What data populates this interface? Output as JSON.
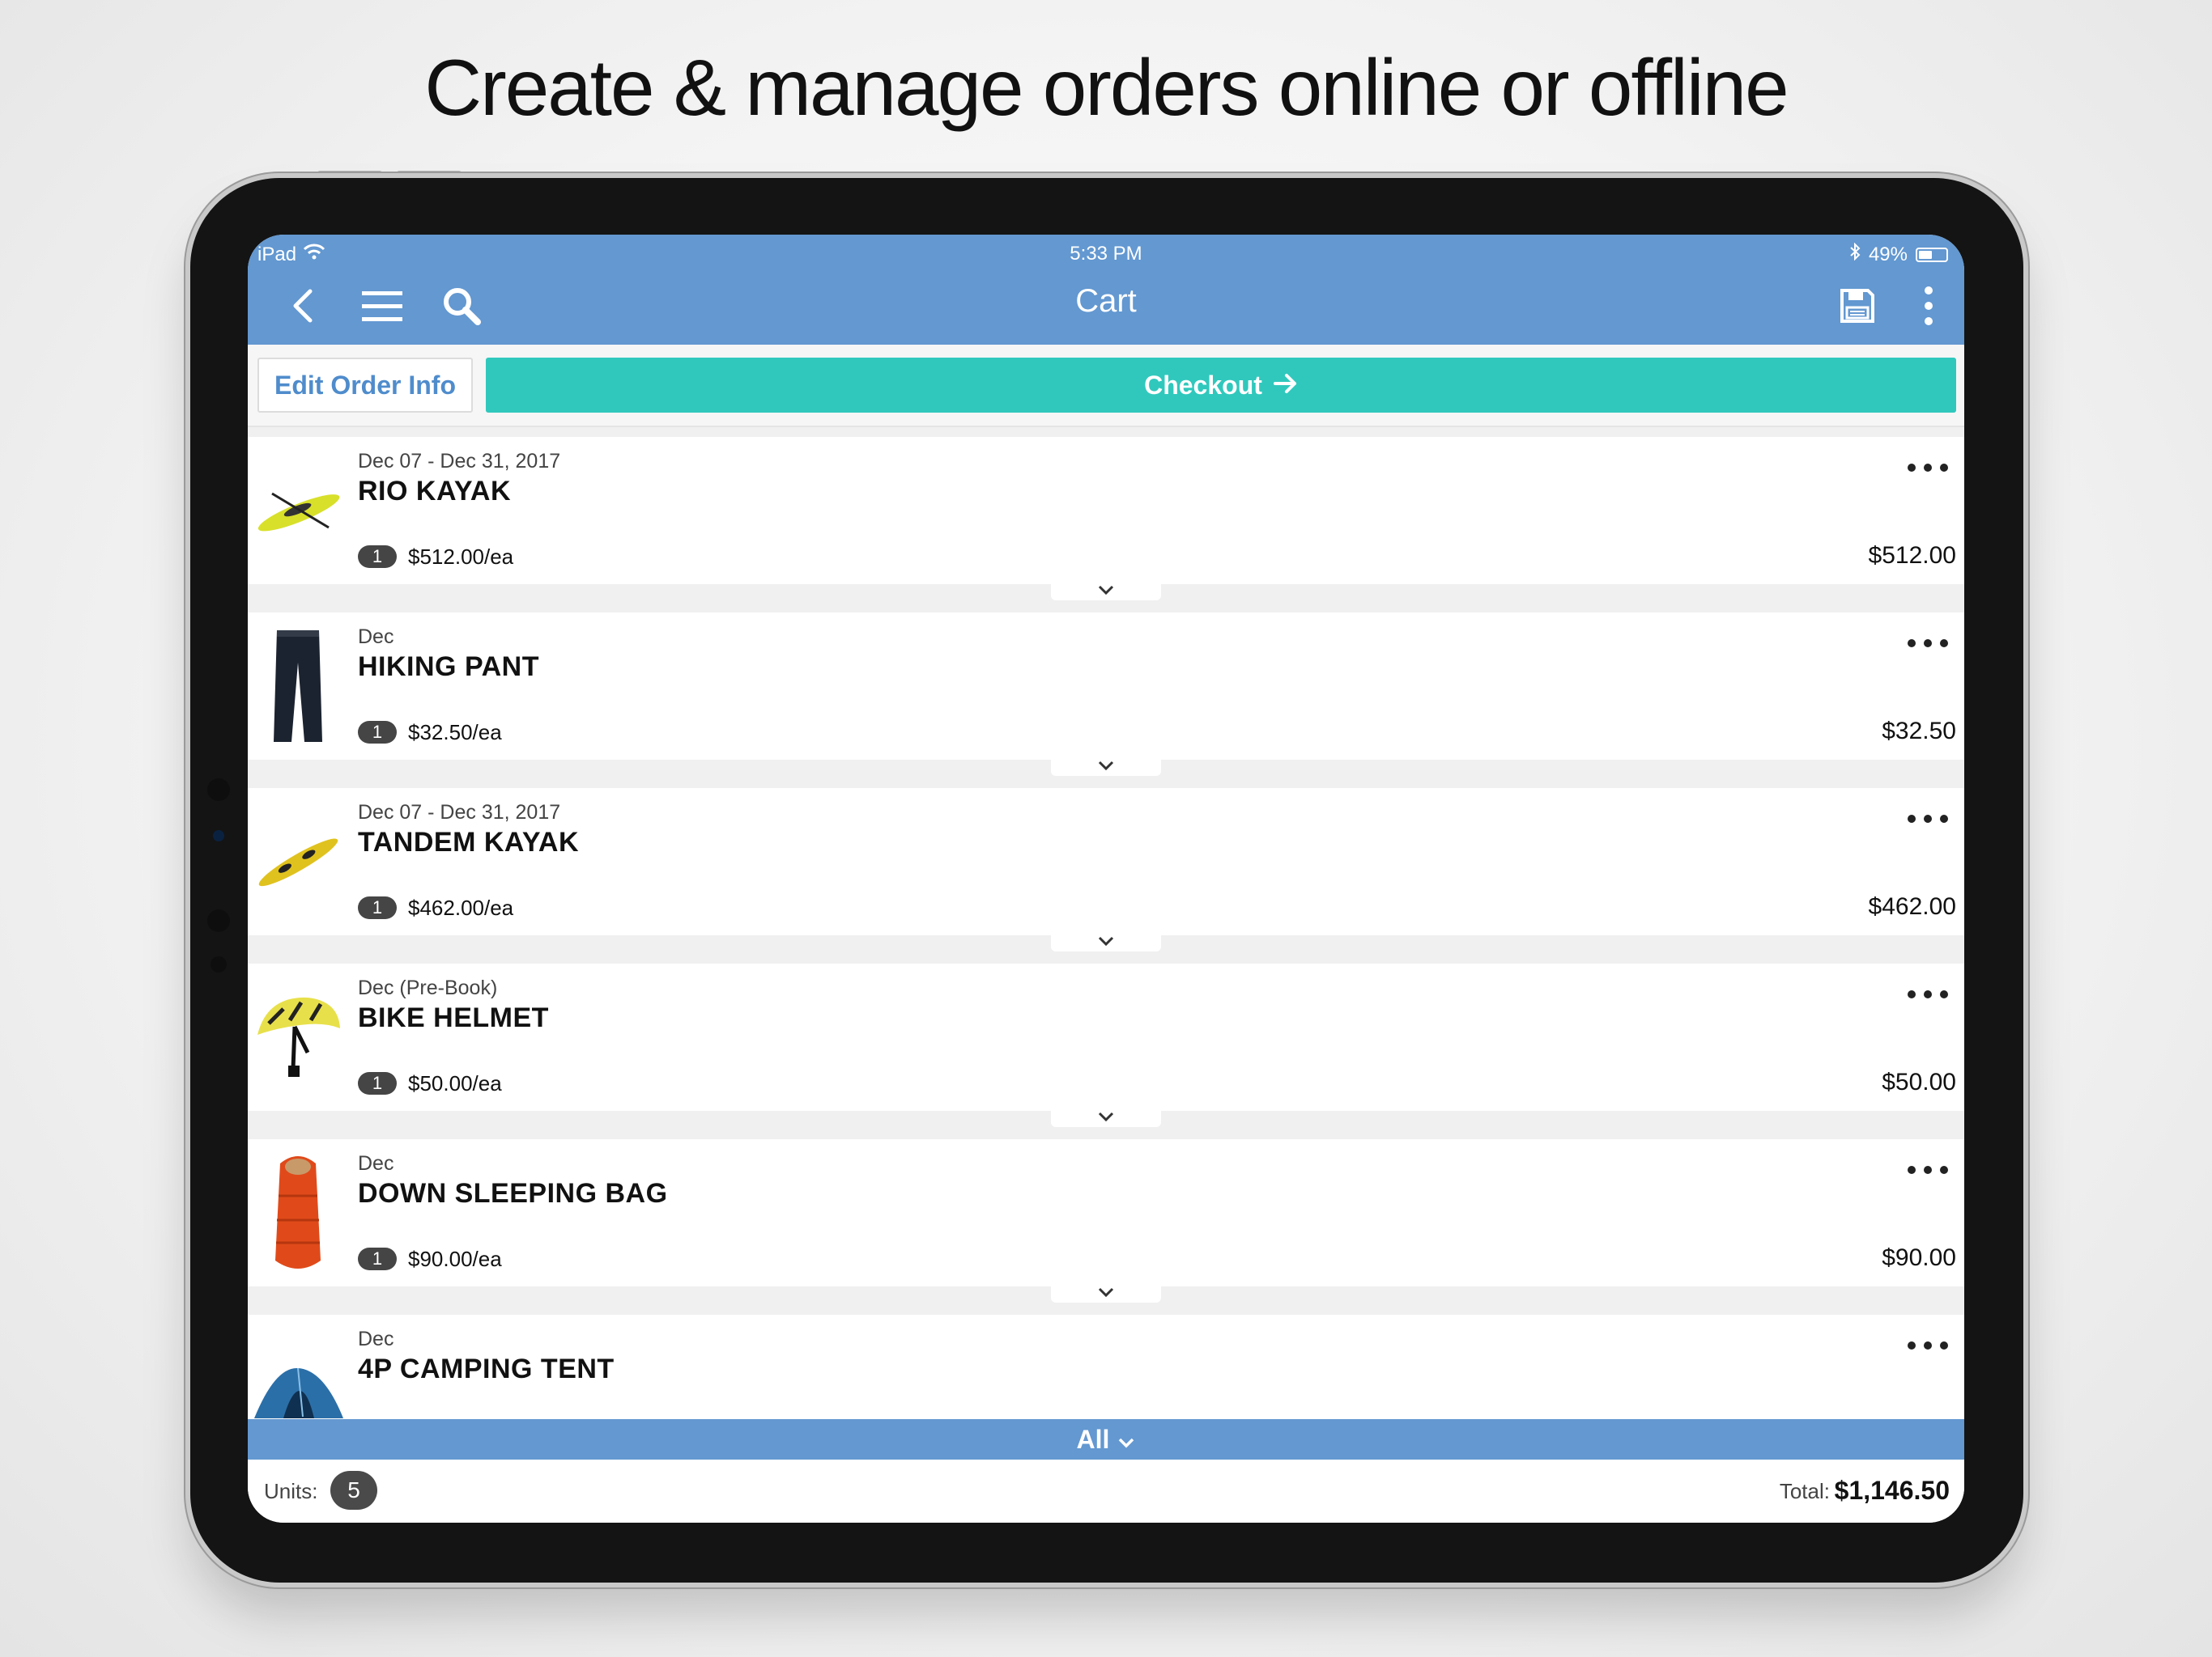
{
  "headline": "Create & manage orders online or offline",
  "status_bar": {
    "device": "iPad",
    "time": "5:33 PM",
    "battery": "49%"
  },
  "nav": {
    "title": "Cart"
  },
  "actions": {
    "edit_label": "Edit Order Info",
    "checkout_label": "Checkout"
  },
  "items": [
    {
      "date": "Dec 07 - Dec 31, 2017",
      "name": "RIO KAYAK",
      "qty": "1",
      "unit_price": "$512.00/ea",
      "total": "$512.00",
      "image": "yellow-kayak"
    },
    {
      "date": "Dec",
      "name": "HIKING PANT",
      "qty": "1",
      "unit_price": "$32.50/ea",
      "total": "$32.50",
      "image": "dark-pants"
    },
    {
      "date": "Dec 07 - Dec 31, 2017",
      "name": "TANDEM KAYAK",
      "qty": "1",
      "unit_price": "$462.00/ea",
      "total": "$462.00",
      "image": "tandem-kayak"
    },
    {
      "date": "Dec (Pre-Book)",
      "name": "BIKE HELMET",
      "qty": "1",
      "unit_price": "$50.00/ea",
      "total": "$50.00",
      "image": "bike-helmet"
    },
    {
      "date": "Dec",
      "name": "DOWN SLEEPING BAG",
      "qty": "1",
      "unit_price": "$90.00/ea",
      "total": "$90.00",
      "image": "sleeping-bag"
    },
    {
      "date": "Dec",
      "name": "4P CAMPING TENT",
      "image": "camping-tent"
    }
  ],
  "filter": {
    "label": "All"
  },
  "footer": {
    "units_label": "Units:",
    "units_value": "5",
    "total_label": "Total:",
    "total_value": "$1,146.50"
  },
  "colors": {
    "nav_blue": "#6398d1",
    "checkout_teal": "#30c8bd",
    "edit_text": "#4f8ccc",
    "badge_dark": "#454545"
  },
  "icons": [
    "back-icon",
    "menu-icon",
    "search-icon",
    "save-icon",
    "more-vertical-icon",
    "more-horizontal-icon",
    "chevron-down-icon",
    "arrow-right-icon",
    "wifi-icon",
    "bluetooth-icon",
    "battery-icon"
  ]
}
